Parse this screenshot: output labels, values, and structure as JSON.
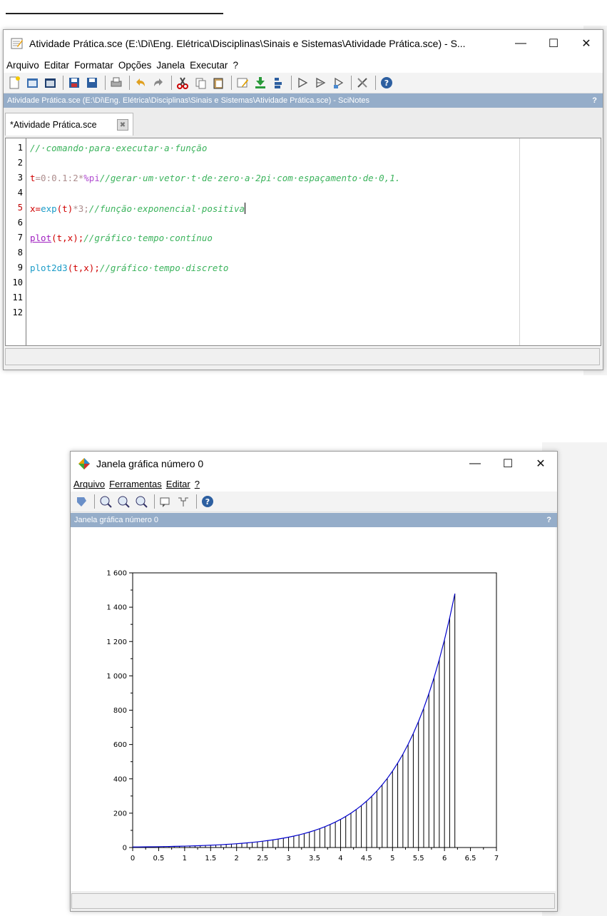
{
  "scinotes": {
    "title": "Atividade Prática.sce (E:\\Di\\Eng. Elétrica\\Disciplinas\\Sinais e Sistemas\\Atividade Prática.sce) - S...",
    "menu": [
      "Arquivo",
      "Editar",
      "Formatar",
      "Opções",
      "Janela",
      "Executar",
      "?"
    ],
    "infobar": "Atividade Prática.sce (E:\\Di\\Eng. Elétrica\\Disciplinas\\Sinais e Sistemas\\Atividade Prática.sce) - SciNotes",
    "help_mark": "?",
    "tab_label": "*Atividade Prática.sce",
    "line_numbers": [
      "1",
      "2",
      "3",
      "4",
      "5",
      "6",
      "7",
      "8",
      "9",
      "10",
      "11",
      "12"
    ],
    "code": {
      "l1_comment": "//·comando·para·executar·a·função",
      "l3_var": "t",
      "l3_expr": "=0:0.1:2*",
      "l3_pi": "%pi",
      "l3_comment": "//gerar·um·vetor·t·de·zero·a·2pi·com·espaçamento·de·0,1.",
      "l5_var": "x",
      "l5_eq": "=",
      "l5_func": "exp",
      "l5_args": "(t)",
      "l5_mul": "*3;",
      "l5_comment": "//função·exponencial·positiva",
      "l7_func": "plot",
      "l7_args": "(t,x);",
      "l7_comment": "//gráfico·tempo·contínuo",
      "l9_func": "plot2d3",
      "l9_args": "(t,x);",
      "l9_comment": "//gráfico·tempo·discreto"
    }
  },
  "graphic": {
    "title": "Janela gráfica número 0",
    "menu": [
      "Arquivo",
      "Ferramentas",
      "Editar",
      "?"
    ],
    "infobar": "Janela gráfica número 0",
    "help_mark": "?"
  },
  "icons": [
    "scinotes-app-icon",
    "scilab-graphic-icon",
    "minimize-icon",
    "maximize-icon",
    "close-icon"
  ],
  "chart_data": {
    "type": "line",
    "title": "",
    "xlabel": "",
    "ylabel": "",
    "xlim": [
      0,
      7
    ],
    "ylim": [
      0,
      1600
    ],
    "x_ticks": [
      "0",
      "0.5",
      "1",
      "1.5",
      "2",
      "2.5",
      "3",
      "3.5",
      "4",
      "4.5",
      "5",
      "5.5",
      "6",
      "6.5",
      "7"
    ],
    "y_ticks": [
      "0",
      "200",
      "400",
      "600",
      "800",
      "1 000",
      "1 200",
      "1 400",
      "1 600"
    ],
    "function": "x = exp(t)*3, t = 0:0.1:2*%pi",
    "t_start": 0,
    "t_step": 0.1,
    "t_end": 6.2,
    "curve_color": "#0000cc",
    "stem_color": "#000000"
  }
}
